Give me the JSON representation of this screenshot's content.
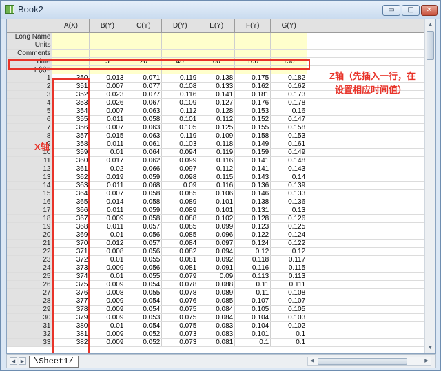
{
  "window": {
    "title": "Book2",
    "buttons": {
      "minimize": "▭",
      "maximize": "□",
      "close": "✕"
    }
  },
  "columns": [
    "A(X)",
    "B(Y)",
    "C(Y)",
    "D(Y)",
    "E(Y)",
    "F(Y)",
    "G(Y)"
  ],
  "meta_rows": [
    {
      "label": "Long Name",
      "values": [
        "",
        "",
        "",
        "",
        "",
        "",
        ""
      ]
    },
    {
      "label": "Units",
      "values": [
        "",
        "",
        "",
        "",
        "",
        "",
        ""
      ]
    },
    {
      "label": "Comments",
      "values": [
        "",
        "",
        "",
        "",
        "",
        "",
        ""
      ]
    },
    {
      "label": "Time",
      "values": [
        "",
        "5",
        "20",
        "40",
        "60",
        "100",
        "150"
      ]
    },
    {
      "label": "F(x)=",
      "values": [
        "",
        "",
        "",
        "",
        "",
        "",
        ""
      ]
    }
  ],
  "rows": [
    [
      "1",
      "350",
      "0.013",
      "0.071",
      "0.119",
      "0.138",
      "0.175",
      "0.182"
    ],
    [
      "2",
      "351",
      "0.007",
      "0.077",
      "0.108",
      "0.133",
      "0.162",
      "0.162"
    ],
    [
      "3",
      "352",
      "0.023",
      "0.077",
      "0.116",
      "0.141",
      "0.181",
      "0.173"
    ],
    [
      "4",
      "353",
      "0.026",
      "0.067",
      "0.109",
      "0.127",
      "0.176",
      "0.178"
    ],
    [
      "5",
      "354",
      "0.007",
      "0.063",
      "0.112",
      "0.128",
      "0.153",
      "0.16"
    ],
    [
      "6",
      "355",
      "0.011",
      "0.058",
      "0.101",
      "0.112",
      "0.152",
      "0.147"
    ],
    [
      "7",
      "356",
      "0.007",
      "0.063",
      "0.105",
      "0.125",
      "0.155",
      "0.158"
    ],
    [
      "8",
      "357",
      "0.015",
      "0.063",
      "0.119",
      "0.109",
      "0.158",
      "0.153"
    ],
    [
      "9",
      "358",
      "0.011",
      "0.061",
      "0.103",
      "0.118",
      "0.149",
      "0.161"
    ],
    [
      "10",
      "359",
      "0.01",
      "0.064",
      "0.094",
      "0.119",
      "0.159",
      "0.149"
    ],
    [
      "11",
      "360",
      "0.017",
      "0.062",
      "0.099",
      "0.116",
      "0.141",
      "0.148"
    ],
    [
      "12",
      "361",
      "0.02",
      "0.066",
      "0.097",
      "0.112",
      "0.141",
      "0.143"
    ],
    [
      "13",
      "362",
      "0.019",
      "0.059",
      "0.098",
      "0.115",
      "0.143",
      "0.14"
    ],
    [
      "14",
      "363",
      "0.011",
      "0.068",
      "0.09",
      "0.116",
      "0.136",
      "0.139"
    ],
    [
      "15",
      "364",
      "0.007",
      "0.058",
      "0.085",
      "0.106",
      "0.146",
      "0.133"
    ],
    [
      "16",
      "365",
      "0.014",
      "0.058",
      "0.089",
      "0.101",
      "0.138",
      "0.136"
    ],
    [
      "17",
      "366",
      "0.011",
      "0.059",
      "0.089",
      "0.101",
      "0.131",
      "0.13"
    ],
    [
      "18",
      "367",
      "0.009",
      "0.058",
      "0.088",
      "0.102",
      "0.128",
      "0.126"
    ],
    [
      "19",
      "368",
      "0.011",
      "0.057",
      "0.085",
      "0.099",
      "0.123",
      "0.125"
    ],
    [
      "20",
      "369",
      "0.01",
      "0.056",
      "0.085",
      "0.096",
      "0.122",
      "0.124"
    ],
    [
      "21",
      "370",
      "0.012",
      "0.057",
      "0.084",
      "0.097",
      "0.124",
      "0.122"
    ],
    [
      "22",
      "371",
      "0.008",
      "0.056",
      "0.082",
      "0.094",
      "0.12",
      "0.12"
    ],
    [
      "23",
      "372",
      "0.01",
      "0.055",
      "0.081",
      "0.092",
      "0.118",
      "0.117"
    ],
    [
      "24",
      "373",
      "0.009",
      "0.056",
      "0.081",
      "0.091",
      "0.116",
      "0.115"
    ],
    [
      "25",
      "374",
      "0.01",
      "0.055",
      "0.079",
      "0.09",
      "0.113",
      "0.113"
    ],
    [
      "26",
      "375",
      "0.009",
      "0.054",
      "0.078",
      "0.088",
      "0.11",
      "0.111"
    ],
    [
      "27",
      "376",
      "0.008",
      "0.055",
      "0.078",
      "0.089",
      "0.11",
      "0.108"
    ],
    [
      "28",
      "377",
      "0.009",
      "0.054",
      "0.076",
      "0.085",
      "0.107",
      "0.107"
    ],
    [
      "29",
      "378",
      "0.009",
      "0.054",
      "0.075",
      "0.084",
      "0.105",
      "0.105"
    ],
    [
      "30",
      "379",
      "0.009",
      "0.053",
      "0.075",
      "0.084",
      "0.104",
      "0.103"
    ],
    [
      "31",
      "380",
      "0.01",
      "0.054",
      "0.075",
      "0.083",
      "0.104",
      "0.102"
    ],
    [
      "32",
      "381",
      "0.009",
      "0.052",
      "0.073",
      "0.083",
      "0.101",
      "0.1"
    ],
    [
      "33",
      "382",
      "0.009",
      "0.052",
      "0.073",
      "0.081",
      "0.1",
      "0.1"
    ]
  ],
  "annotations": {
    "z_axis_line1": "Z轴（先插入一行，在",
    "z_axis_line2": "设置相应时间值）",
    "x_axis": "X轴"
  },
  "sheet_tab": "Sheet1",
  "accent_color": "#e8342a"
}
